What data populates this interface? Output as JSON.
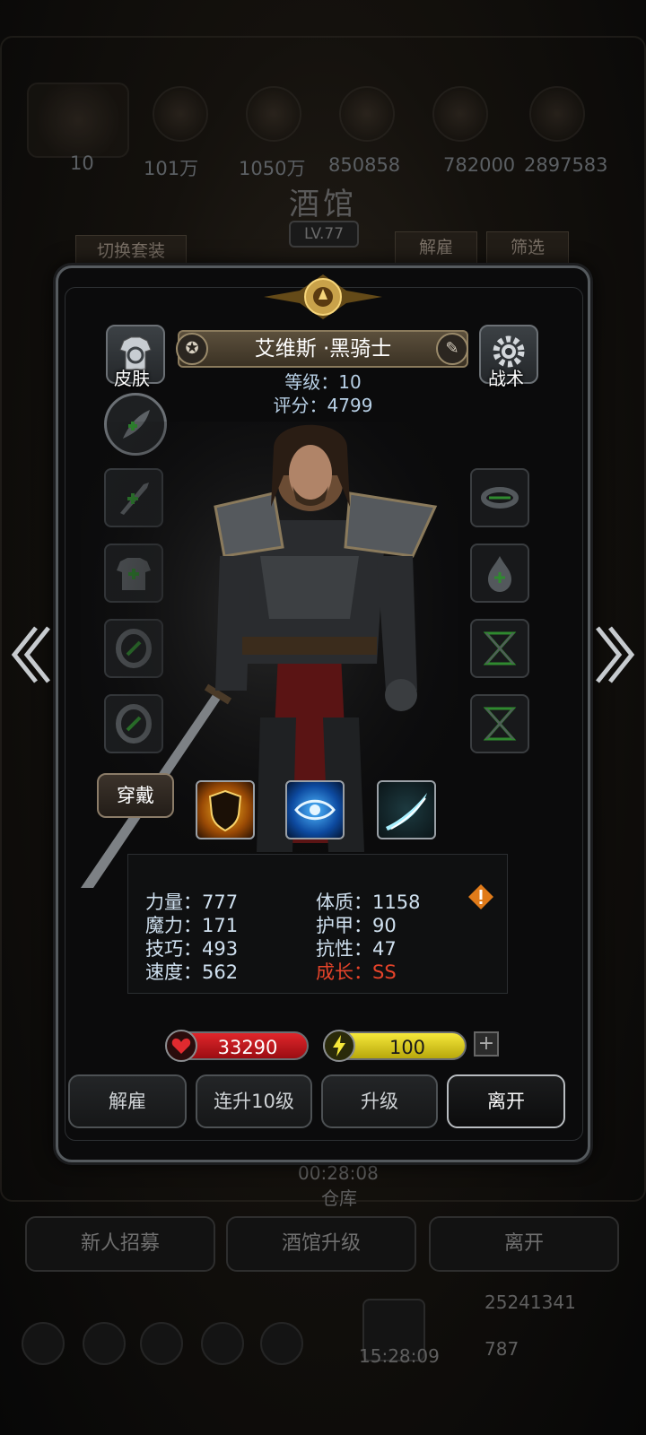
{
  "background": {
    "resources": [
      "101万",
      "1050万",
      "850858",
      "782000",
      "2897583"
    ],
    "resource_prefix": "10",
    "title": "酒馆",
    "level": "LV.77",
    "tabs": {
      "switch_set": "切换套装",
      "dismiss": "解雇",
      "filter": "筛选"
    },
    "timer": "00:28:08",
    "warehouse": "仓库",
    "buttons": {
      "recruit": "新人招募",
      "upgrade_tavern": "酒馆升级",
      "leave": "离开"
    },
    "gold": "25241341",
    "gems": "787",
    "clock": "15:28:09"
  },
  "hero": {
    "name": "艾维斯 ·黑骑士",
    "level_text": "等级：10",
    "score_text": "评分：4799"
  },
  "side": {
    "skin_label": "皮肤",
    "tactics_label": "战术",
    "wear_label": "穿戴"
  },
  "stats": {
    "left": [
      "力量：777",
      "魔力：171",
      "技巧：493",
      "速度：562"
    ],
    "right": [
      "体质：1158",
      "护甲：90",
      "抗性：47"
    ],
    "growth": "成长：SS"
  },
  "bars": {
    "hp": "33290",
    "energy": "100",
    "plus": "+"
  },
  "actions": {
    "dismiss": "解雇",
    "level10": "连升10级",
    "upgrade": "升级",
    "leave": "离开"
  },
  "nav": {
    "prev": "«",
    "next": "»"
  },
  "colors": {
    "accent_gold": "#c9a24a",
    "hp_red": "#c4141a",
    "energy_yellow": "#e3d313",
    "growth_red": "#e4432a"
  },
  "icons": [
    "shirt-refresh-icon",
    "gear-icon",
    "medal-icon",
    "edit-icon",
    "feather-icon",
    "sword-icon",
    "armor-icon",
    "ring-icon",
    "amulet-icon",
    "flame-icon",
    "rune-icon",
    "shield-skill-icon",
    "eye-skill-icon",
    "slash-skill-icon",
    "heart-icon",
    "lightning-icon",
    "warning-icon"
  ]
}
